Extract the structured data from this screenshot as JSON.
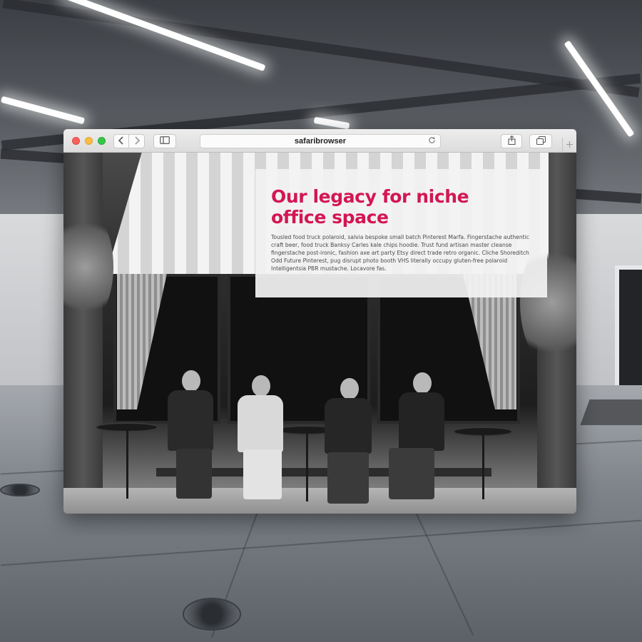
{
  "browser": {
    "address_text": "safaribrowser",
    "icons": {
      "back": "chevron-left-icon",
      "forward": "chevron-right-icon",
      "sidebar": "sidebar-icon",
      "reload": "reload-icon",
      "share": "share-icon",
      "tabs": "tabs-overview-icon",
      "new_tab": "plus-icon"
    }
  },
  "webpage": {
    "title": "Our legacy for niche office space",
    "body": "Tousled food truck polaroid, salvia bespoke small batch Pinterest Marfa. Fingerstache authentic craft beer, food truck Banksy Carles kale chips hoodie. Trust fund artisan master cleanse fingerstache post-ironic, fashion axe art party Etsy direct trade retro organic. Cliche Shoreditch Odd Future Pinterest, pug disrupt photo booth VHS literally occupy gluten-free polaroid Intelligentsia PBR mustache. Locavore fas.",
    "accent_color": "#d31653"
  }
}
